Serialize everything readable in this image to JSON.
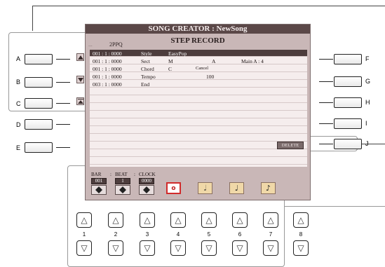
{
  "header": {
    "title": "SONG CREATOR : NewSong",
    "subtitle": "STEP RECORD",
    "resolution": "2PPQ",
    "dots": "..."
  },
  "left_buttons": [
    {
      "label": "A"
    },
    {
      "label": "B"
    },
    {
      "label": "C"
    },
    {
      "label": "D"
    },
    {
      "label": "E"
    }
  ],
  "right_buttons": [
    {
      "label": "F"
    },
    {
      "label": "G"
    },
    {
      "label": "H"
    },
    {
      "label": "I"
    },
    {
      "label": "J"
    }
  ],
  "events": [
    {
      "time": "001 : 1 : 0000",
      "event": "Style",
      "p1": "EasyPop",
      "p2": "",
      "p3": "",
      "selected": true
    },
    {
      "time": "001 : 1 : 0000",
      "event": "Sect",
      "p1": "M",
      "p2": "A",
      "p3": "Main A   : 4",
      "selected": false
    },
    {
      "time": "001 : 1 : 0000",
      "event": "Chord",
      "p1": "C",
      "p2": "Cancel",
      "p3": "",
      "selected": false
    },
    {
      "time": "001 : 1 : 0000",
      "event": "Tempo",
      "p1": "",
      "p2": "100",
      "p3": "",
      "selected": false
    },
    {
      "time": "003 : 1 : 0000",
      "event": "End",
      "p1": "",
      "p2": "",
      "p3": "",
      "selected": false
    }
  ],
  "delete_label": "DELETE",
  "position": {
    "bar_caption": "BAR",
    "beat_caption": "BEAT",
    "clock_caption": "CLOCK",
    "sep": ":",
    "bar": "001",
    "beat": "1",
    "clock": "0000"
  },
  "notes": [
    {
      "name": "whole-note",
      "glyph": "o",
      "active": true
    },
    {
      "name": "half-note",
      "glyph": "𝅗𝅥",
      "active": false
    },
    {
      "name": "quarter-note",
      "glyph": "♩",
      "active": false
    },
    {
      "name": "eighth-note",
      "glyph": "♪",
      "active": false
    }
  ],
  "bottom_buttons": [
    "1",
    "2",
    "3",
    "4",
    "5",
    "6",
    "7",
    "8"
  ],
  "up_glyph": "△",
  "down_glyph": "▽"
}
